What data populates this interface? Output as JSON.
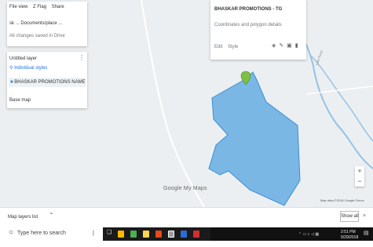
{
  "left_panel": {
    "tabs": [
      "File view",
      "Z Flag",
      "Share"
    ],
    "file_line": "sk ... Documents/place ... ",
    "sub_line": "All changes saved in Drive",
    "layer_title": "Untitled layer",
    "layer_sub": "Individual styles",
    "layer_item": "BHASKAR PROMOTIONS NAME",
    "base_label": "Base map"
  },
  "info_card": {
    "title": "BHASKAR PROMOTIONS - TG",
    "subtitle": "Coordinates and polygon details",
    "actions": [
      "Edit",
      "Style"
    ]
  },
  "map": {
    "logo": "Google My Maps",
    "attribution": "Map data ©2018 Google  Terms",
    "zoom_in": "+",
    "zoom_out": "−",
    "road_label": "Lake Road"
  },
  "bottom_strip": {
    "left_text": "Map layers list",
    "right_label": "Show all",
    "close": "×"
  },
  "taskbar": {
    "search_placeholder": "Type here to search",
    "time": "2:51 PM",
    "date": "5/29/2018"
  },
  "colors": {
    "polygon_fill": "#6fb0e3",
    "polygon_stroke": "#3a8fd3",
    "marker": "#7cc142",
    "water": "#94c3e8"
  }
}
